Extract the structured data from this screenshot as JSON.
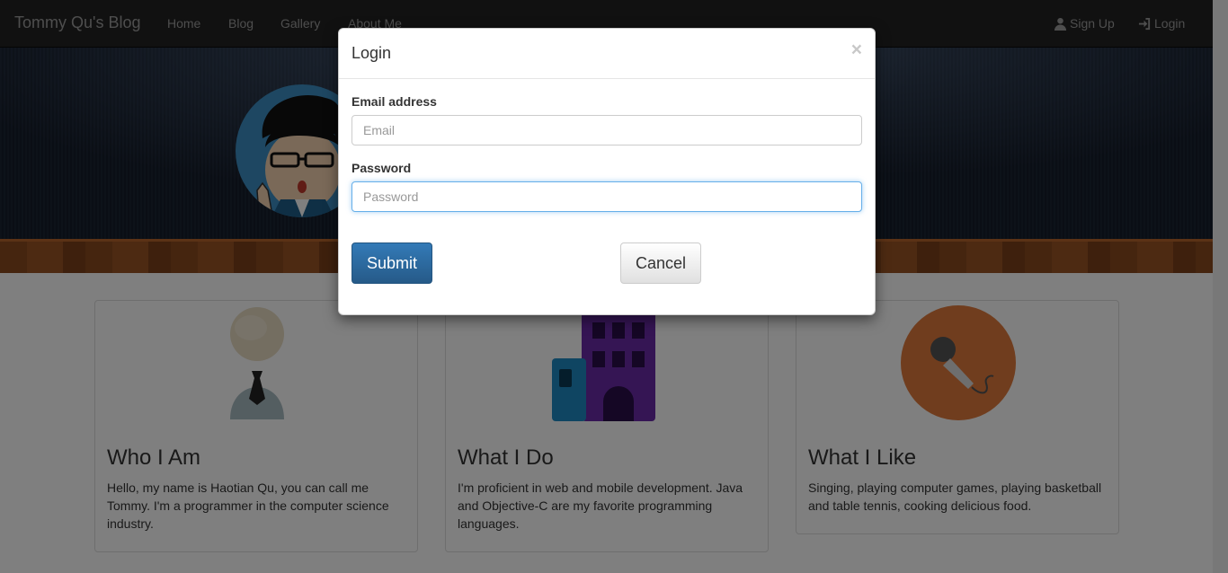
{
  "navbar": {
    "brand": "Tommy Qu's Blog",
    "links": [
      "Home",
      "Blog",
      "Gallery",
      "About Me"
    ],
    "signup": "Sign Up",
    "login": "Login"
  },
  "cards": [
    {
      "title": "Who I Am",
      "text": "Hello, my name is Haotian Qu, you can call me Tommy. I'm a programmer in the computer science industry."
    },
    {
      "title": "What I Do",
      "text": "I'm proficient in web and mobile development. Java and Objective-C are my favorite programming languages."
    },
    {
      "title": "What I Like",
      "text": "Singing, playing computer games, playing basketball and table tennis, cooking delicious food."
    }
  ],
  "modal": {
    "title": "Login",
    "close": "×",
    "email_label": "Email address",
    "email_placeholder": "Email",
    "password_label": "Password",
    "password_placeholder": "Password",
    "submit": "Submit",
    "cancel": "Cancel"
  },
  "colors": {
    "primary": "#337ab7",
    "navbar": "#222222",
    "like_circle": "#e07a3c"
  }
}
